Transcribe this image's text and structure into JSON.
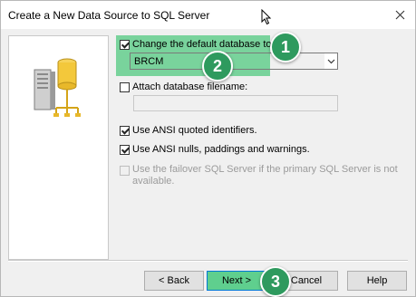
{
  "window": {
    "title": "Create a New Data Source to SQL Server"
  },
  "options": {
    "change_db": {
      "label": "Change the default database to:",
      "checked": true
    },
    "database_combo": {
      "value": "BRCM"
    },
    "attach_db": {
      "label": "Attach database filename:",
      "checked": false
    },
    "ansi_quoted": {
      "label": "Use ANSI quoted identifiers.",
      "checked": true
    },
    "ansi_nulls": {
      "label": "Use ANSI nulls, paddings and warnings.",
      "checked": true
    },
    "failover": {
      "label_line1": "Use the failover SQL Server if the primary SQL Server is not",
      "label_line2": "available.",
      "checked": false,
      "enabled": false
    }
  },
  "buttons": {
    "back": "< Back",
    "next": "Next >",
    "cancel": "Cancel",
    "help": "Help"
  },
  "annotations": {
    "step1": "1",
    "step2": "2",
    "step3": "3",
    "color": "#2e9a5e",
    "highlight_color": "#6ccf92"
  }
}
